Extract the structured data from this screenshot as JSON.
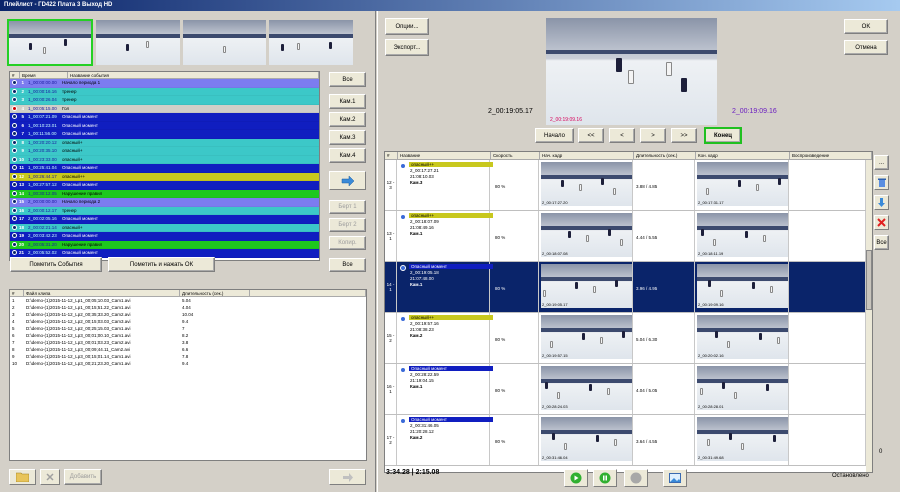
{
  "window_title": "Плейлист - ГD422 Плата 3 Выход HD",
  "left": {
    "event_columns": [
      "#",
      "Время",
      "Название события"
    ],
    "events": [
      {
        "n": "1",
        "time": "1_00:00:00.00",
        "label": "Начало периода 1",
        "color": "#7c7cf0",
        "icon": "#0a246a"
      },
      {
        "n": "2",
        "time": "1_00:00:16.16",
        "label": "тренер",
        "color": "#3cc8c8",
        "icon": "#0a246a"
      },
      {
        "n": "3",
        "time": "1_00:00:26.04",
        "label": "тренер",
        "color": "#3cc8c8",
        "icon": "#0a246a"
      },
      {
        "n": "4",
        "time": "1_00:05:15.00",
        "label": "Гол",
        "color": "#d0cfc8",
        "icon": "#d00000"
      },
      {
        "n": "5",
        "time": "1_00:07:21.09",
        "label": "Опасный момент",
        "color": "#101ec0",
        "icon": "#0a246a"
      },
      {
        "n": "6",
        "time": "1_00:10:23.01",
        "label": "Опасный момент",
        "color": "#101ec0",
        "icon": "#0a246a"
      },
      {
        "n": "7",
        "time": "1_00:11:56.00",
        "label": "Опасный момент",
        "color": "#101ec0",
        "icon": "#0a246a"
      },
      {
        "n": "8",
        "time": "1_00:20:20.12",
        "label": "опасный+",
        "color": "#3cc8c8",
        "icon": "#0a246a"
      },
      {
        "n": "9",
        "time": "1_00:20:35.10",
        "label": "опасный+",
        "color": "#3cc8c8",
        "icon": "#0a246a"
      },
      {
        "n": "10",
        "time": "1_00:23:33.00",
        "label": "опасный+",
        "color": "#3cc8c8",
        "icon": "#0a246a"
      },
      {
        "n": "11",
        "time": "1_00:25:41.04",
        "label": "Опасный момент",
        "color": "#101ec0",
        "icon": "#0a246a"
      },
      {
        "n": "12",
        "time": "1_00:26:44.17",
        "label": "опасный++",
        "color": "#c8c81e",
        "icon": "#0a246a"
      },
      {
        "n": "13",
        "time": "1_00:27:57.12",
        "label": "Опасный момент",
        "color": "#101ec0",
        "icon": "#0a246a"
      },
      {
        "n": "14",
        "time": "1_00:30:12.05",
        "label": "Нарушение правил",
        "color": "#1ec81e",
        "icon": "#0a246a"
      },
      {
        "n": "15",
        "time": "2_00:00:00.00",
        "label": "Начало периода 2",
        "color": "#7c7cf0",
        "icon": "#0a246a"
      },
      {
        "n": "16",
        "time": "2_00:00:12.17",
        "label": "тренер",
        "color": "#3cc8c8",
        "icon": "#0a246a"
      },
      {
        "n": "17",
        "time": "2_00:02:05.16",
        "label": "Опасный момент",
        "color": "#101ec0",
        "icon": "#0a246a"
      },
      {
        "n": "18",
        "time": "2_00:02:21.14",
        "label": "опасный+",
        "color": "#3cc8c8",
        "icon": "#0a246a"
      },
      {
        "n": "19",
        "time": "2_00:03:42.23",
        "label": "Опасный момент",
        "color": "#101ec0",
        "icon": "#0a246a"
      },
      {
        "n": "20",
        "time": "2_00:05:31.20",
        "label": "Нарушение правил",
        "color": "#1ec81e",
        "icon": "#0a246a"
      },
      {
        "n": "21",
        "time": "2_00:05:52.02",
        "label": "Опасный момент",
        "color": "#101ec0",
        "icon": "#0a246a"
      }
    ],
    "btn_all_top": "Все",
    "btn_cam1": "Кам.1",
    "btn_cam2": "Кам.2",
    "btn_cam3": "Кам.3",
    "btn_cam4": "Кам.4",
    "btn_dis1": "Берт 1",
    "btn_dis2": "Берт 2",
    "btn_dis3": "Копир.",
    "btn_mark_events": "Пометить События",
    "btn_mark_ok": "Пометить и нажать ОК",
    "btn_all_bottom": "Все",
    "clip_columns": [
      "#",
      "Файл клипа",
      "Длительность (сек.)"
    ],
    "clips": [
      {
        "n": "1",
        "file": "D:\\demo-(1)2015-11-12_Lp1_00;05;10.03_Cam1.avi",
        "dur": "5.04"
      },
      {
        "n": "2",
        "file": "D:\\demo-(1)2015-11-12_Lp1_00;15;51.22_Cam1.avi",
        "dur": "4.04"
      },
      {
        "n": "3",
        "file": "D:\\demo-(1)2015-11-12_Lp2_00;35;33.20_Cam2.avi",
        "dur": "10.04"
      },
      {
        "n": "4",
        "file": "D:\\demo-(1)2015-11-12_Lp2_00;15;03.03_Cam3.avi",
        "dur": "9.4"
      },
      {
        "n": "5",
        "file": "D:\\demo-(1)2015-11-12_Lp2_00;25;15.03_Cam1.avi",
        "dur": "7"
      },
      {
        "n": "6",
        "file": "D:\\demo-(1)2015-11-12_Lp3_00;01;00.10_Cam1.avi",
        "dur": "8.2"
      },
      {
        "n": "7",
        "file": "D:\\demo-(1)2015-11-12_Lp3_00;01;03.23_Cam2.avi",
        "dur": "3.8"
      },
      {
        "n": "8",
        "file": "D:\\demo-(1)2015-11-12_Lp3_00;09;44.11_Cam2.avi",
        "dur": "6.6"
      },
      {
        "n": "9",
        "file": "D:\\demo-(1)2015-11-12_Lp3_00;15;01.14_Cam1.avi",
        "dur": "7.8"
      },
      {
        "n": "10",
        "file": "D:\\demo-(1)2015-11-12_Lp3_00;21;23.20_Cam1.avi",
        "dur": "9.4"
      }
    ],
    "btn_folder_label": "Добавить"
  },
  "right": {
    "btn_options": "Опции...",
    "btn_export": "Экспорт...",
    "btn_ok": "OK",
    "btn_cancel": "Отмена",
    "preview_ts": "2_00:19:09.16",
    "time_left": "2_00:19:05.17",
    "time_right": "2_00:19:09.16",
    "nav": {
      "start": "Начало",
      "prev_fast": "<<",
      "prev": "<",
      "next": ">",
      "next_fast": ">>",
      "end": "Конец"
    },
    "columns": [
      "#",
      "Название",
      "Скорость",
      "Нач. кадр",
      "Длительность (сек.)",
      "Кон. кадр",
      "Воспроизведение"
    ],
    "rows": [
      {
        "num": "12 - 3",
        "label": "опасный++",
        "label_color": "#c8c81e",
        "label_text": "#000",
        "t1": "2_00:17:27.21",
        "t2": "21:08:10.03",
        "cam": "Кам.3",
        "speed": "80 %",
        "f1": "2_00:17:27.20",
        "dur": "3.88 / 4.85",
        "f2": "2_00:17:31.17",
        "sel": false
      },
      {
        "num": "13 - 1",
        "label": "опасный++",
        "label_color": "#c8c81e",
        "label_text": "#000",
        "t1": "2_00:18:07.09",
        "t2": "21:08:49.16",
        "cam": "Кам.1",
        "speed": "80 %",
        "f1": "2_00:18:07.08",
        "dur": "4.44 / 5.55",
        "f2": "2_00:18:11.19",
        "sel": false
      },
      {
        "num": "14 - 1",
        "label": "Опасный момент",
        "label_color": "#101ec0",
        "label_text": "#fff",
        "t1": "2_00:19:05.18",
        "t2": "21:07:48.00",
        "cam": "Кам.1",
        "speed": "80 %",
        "f1": "2_00:19:05.17",
        "dur": "3.96 / 4.95",
        "f2": "2_00:19:09.16",
        "sel": true
      },
      {
        "num": "15 - 2",
        "label": "опасный++",
        "label_color": "#c8c81e",
        "label_text": "#000",
        "t1": "2_00:19:57.16",
        "t2": "21:08:38.23",
        "cam": "Кам.2",
        "speed": "80 %",
        "f1": "2_00:19:57.15",
        "dur": "5.04 / 6.30",
        "f2": "2_00:20:02.16",
        "sel": false
      },
      {
        "num": "16 - 1",
        "label": "Опасный момент",
        "label_color": "#101ec0",
        "label_text": "#fff",
        "t1": "2_00:28:22.59",
        "t2": "21:19:04.15",
        "cam": "Кам.1",
        "speed": "80 %",
        "f1": "2_00:28:24.03",
        "dur": "4.04 / 5.05",
        "f2": "2_00:28:28.01",
        "sel": false
      },
      {
        "num": "17 - 2",
        "label": "Опасный момент",
        "label_color": "#101ec0",
        "label_text": "#fff",
        "t1": "2_00:31:46.05",
        "t2": "21:20:28.12",
        "cam": "Кам.2",
        "speed": "80 %",
        "f1": "2_00:31:46.04",
        "dur": "3.64 / 4.55",
        "f2": "2_00:31:49.68",
        "sel": false
      }
    ],
    "side_buttons": {
      "more": "...",
      "all": "Все"
    },
    "side_zero": "0",
    "total_time": "3:34.28 | 2:15.08",
    "status": "Остановлено"
  }
}
